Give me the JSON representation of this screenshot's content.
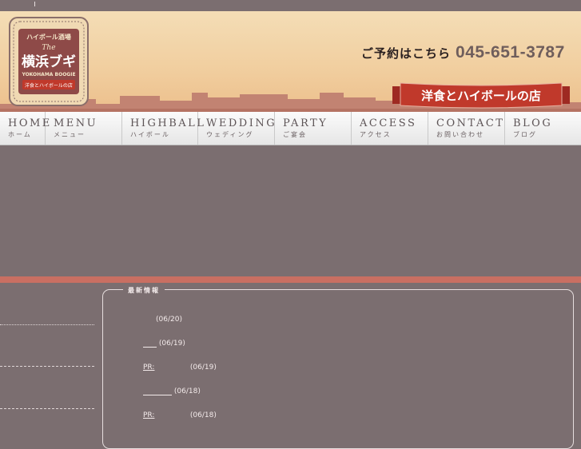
{
  "header": {
    "logo": {
      "top_text": "ハイボール酒場",
      "script_text": "The",
      "main_text": "横浜ブギ",
      "romaji": "YOKOHAMA BOOGIE",
      "tagline": "洋食とハイボールの店"
    },
    "reserve_label": "ご予約はこちら",
    "phone": "045-651-3787",
    "ribbon_text": "洋食とハイボールの店"
  },
  "nav": [
    {
      "en": "HOME",
      "jp": "ホーム"
    },
    {
      "en": "MENU",
      "jp": "メニュー"
    },
    {
      "en": "HIGHBALL",
      "jp": "ハイボール"
    },
    {
      "en": "WEDDING",
      "jp": "ウェディング"
    },
    {
      "en": "PARTY",
      "jp": "ご宴会"
    },
    {
      "en": "ACCESS",
      "jp": "アクセス"
    },
    {
      "en": "CONTACT",
      "jp": "お問い合わせ"
    },
    {
      "en": "BLOG",
      "jp": "ブログ"
    }
  ],
  "news": {
    "title": "最新情報",
    "items": [
      {
        "link": "",
        "date": "(06/20)"
      },
      {
        "link": "",
        "date": "(06/19)"
      },
      {
        "link": "PR:",
        "date": "(06/19)"
      },
      {
        "link": "",
        "date": "(06/18)"
      },
      {
        "link": "PR:",
        "date": "(06/18)"
      }
    ]
  },
  "colors": {
    "background": "#7b6e70",
    "band": "#c96f62",
    "ribbon": "#c0392b",
    "header_top": "#f4ddb6"
  }
}
